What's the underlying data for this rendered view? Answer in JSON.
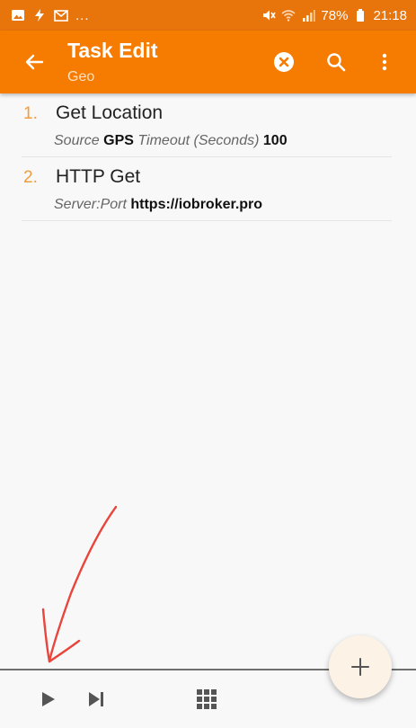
{
  "status_bar": {
    "dots": "...",
    "battery": "78%",
    "time": "21:18"
  },
  "app_bar": {
    "title": "Task Edit",
    "subtitle": "Geo",
    "icons": [
      "back-arrow-icon",
      "clear-circle-icon",
      "search-icon",
      "more-vert-icon"
    ]
  },
  "actions": [
    {
      "number": "1.",
      "name": "Get Location",
      "params": [
        {
          "key": "Source",
          "value": "GPS"
        },
        {
          "key": "Timeout (Seconds)",
          "value": "100"
        }
      ]
    },
    {
      "number": "2.",
      "name": "HTTP Get",
      "params": [
        {
          "key": "Server:Port",
          "value": "https://iobroker.pro"
        }
      ]
    }
  ],
  "bottom_bar": {
    "icons": [
      "play-icon",
      "step-forward-icon",
      "grid-icon",
      "add-icon"
    ]
  },
  "colors": {
    "status_bar": "#e8740c",
    "app_bar": "#f57c00",
    "accent_number": "#f39c3a",
    "annotation_arrow": "#e8453c"
  }
}
